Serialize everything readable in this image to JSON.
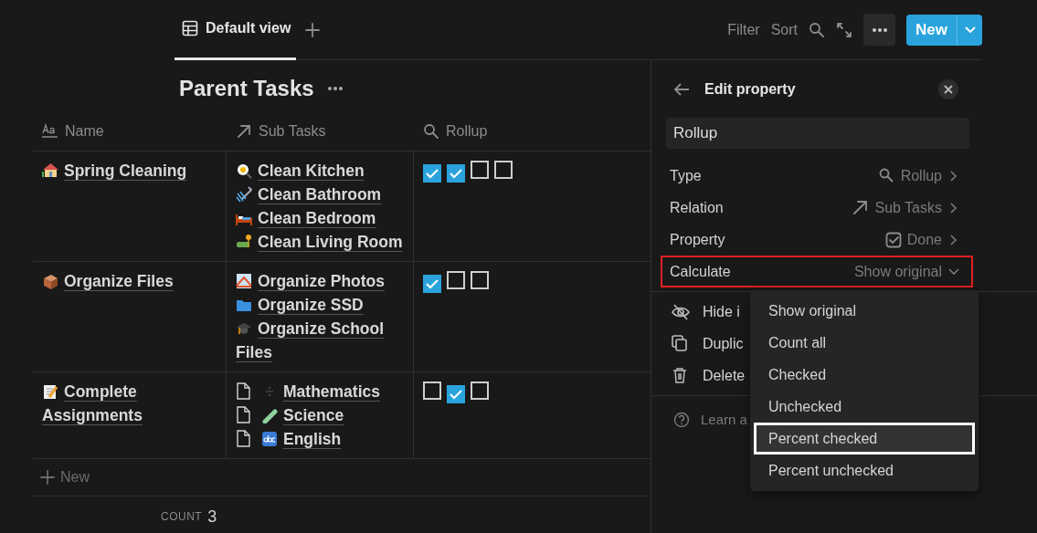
{
  "view_tabs": [
    {
      "label": "Default view",
      "selected": true
    }
  ],
  "toolbar": {
    "filter": "Filter",
    "sort": "Sort",
    "new_button": "New"
  },
  "database": {
    "title": "Parent Tasks",
    "columns": [
      "Name",
      "Sub Tasks",
      "Rollup"
    ],
    "rows": [
      {
        "name": "Spring Cleaning",
        "sub_tasks": [
          {
            "kind": "emoji",
            "label": "Clean Kitchen"
          },
          {
            "kind": "emoji",
            "label": "Clean Bathroom"
          },
          {
            "kind": "emoji",
            "label": "Clean Bedroom"
          },
          {
            "kind": "emoji",
            "label": "Clean Living Room"
          }
        ],
        "rollup": [
          {
            "checked": true
          },
          {
            "checked": true
          },
          {
            "checked": false
          },
          {
            "checked": false
          }
        ]
      },
      {
        "name": "Organize Files",
        "sub_tasks": [
          {
            "kind": "emoji",
            "label": "Organize Photos"
          },
          {
            "kind": "emoji",
            "label": "Organize SSD"
          },
          {
            "kind": "emoji",
            "label": "Organize School Files"
          }
        ],
        "rollup": [
          {
            "checked": true
          },
          {
            "checked": false
          },
          {
            "checked": false
          }
        ]
      },
      {
        "name": "Complete Assignments",
        "sub_tasks": [
          {
            "kind": "page",
            "label": "Mathematics"
          },
          {
            "kind": "page",
            "label": "Science"
          },
          {
            "kind": "page",
            "label": "English"
          }
        ],
        "rollup": [
          {
            "checked": false
          },
          {
            "checked": true
          },
          {
            "checked": false
          }
        ]
      }
    ],
    "new_row": "New",
    "count_label": "COUNT",
    "count_value": "3"
  },
  "panel": {
    "title": "Edit property",
    "name_value": "Rollup",
    "settings": [
      {
        "label": "Type",
        "value": "Rollup",
        "highlighted": false
      },
      {
        "label": "Relation",
        "value": "Sub Tasks",
        "highlighted": false
      },
      {
        "label": "Property",
        "value": "Done",
        "highlighted": false
      },
      {
        "label": "Calculate",
        "value": "Show original",
        "highlighted": true
      }
    ],
    "actions": [
      "Hide i",
      "Duplic",
      "Delete"
    ],
    "help": "Learn a"
  },
  "calculate_menu": [
    {
      "label": "Show original",
      "selected": false
    },
    {
      "label": "Count all",
      "selected": false
    },
    {
      "label": "Checked",
      "selected": false
    },
    {
      "label": "Unchecked",
      "selected": false
    },
    {
      "label": "Percent checked",
      "selected": true
    },
    {
      "label": "Percent unchecked",
      "selected": false
    }
  ]
}
